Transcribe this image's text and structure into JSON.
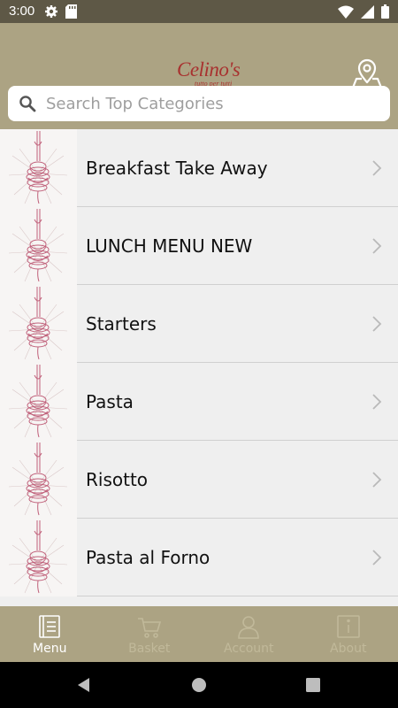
{
  "status_bar": {
    "time": "3:00",
    "left_icons": [
      "gear-icon",
      "sd-card-icon"
    ],
    "right_icons": [
      "wifi-icon",
      "signal-icon",
      "battery-icon"
    ]
  },
  "header": {
    "logo_text": "Celino's",
    "logo_tagline": "tutto per tutti",
    "location_icon": "map-pin-icon"
  },
  "search": {
    "placeholder": "Search Top Categories",
    "value": ""
  },
  "categories": [
    {
      "label": "Breakfast Take Away"
    },
    {
      "label": "LUNCH MENU NEW"
    },
    {
      "label": "Starters"
    },
    {
      "label": "Pasta"
    },
    {
      "label": "Risotto"
    },
    {
      "label": "Pasta al Forno"
    }
  ],
  "bottom_nav": [
    {
      "label": "Menu",
      "icon": "menu-book-icon",
      "active": true
    },
    {
      "label": "Basket",
      "icon": "cart-icon",
      "active": false
    },
    {
      "label": "Account",
      "icon": "person-icon",
      "active": false
    },
    {
      "label": "About",
      "icon": "info-icon",
      "active": false
    }
  ],
  "colors": {
    "header_bg": "#aca383",
    "status_bar_bg": "#5e5846",
    "brand_red": "#a8312f",
    "list_bg": "#efefef",
    "nav_active": "#ffffff",
    "nav_inactive": "#c1b99a"
  }
}
